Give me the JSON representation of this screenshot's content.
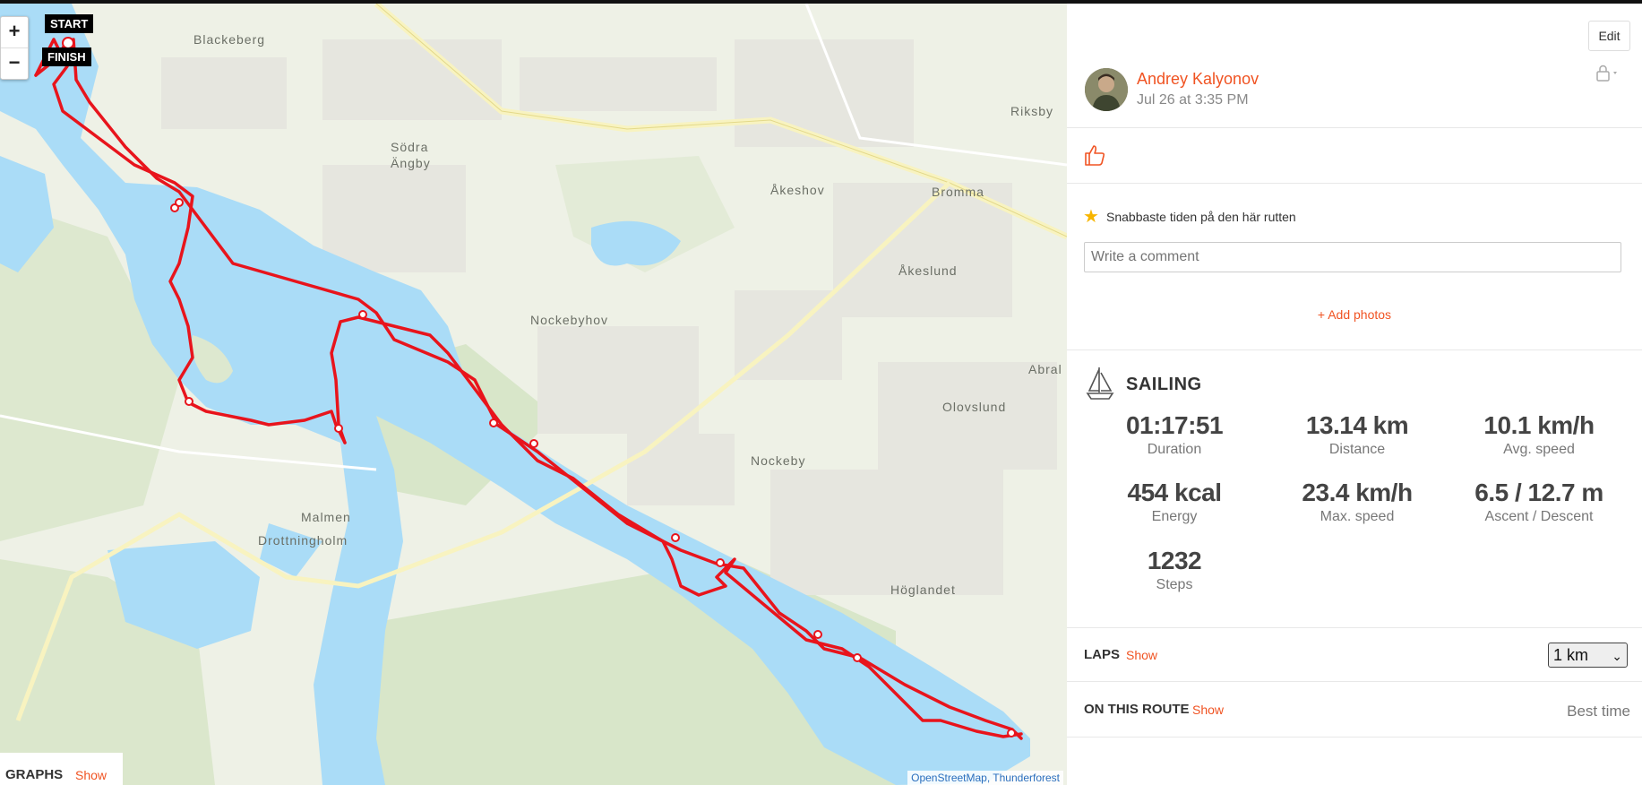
{
  "map": {
    "zoom_in": "+",
    "zoom_out": "−",
    "start_label": "START",
    "finish_label": "FINISH",
    "attribution": "OpenStreetMap, Thunderforest",
    "places": [
      "Blackeberg",
      "Södra",
      "Ängby",
      "Åkeshov",
      "Bromma",
      "Riksby",
      "Åkeslund",
      "Nockebyhov",
      "Abral",
      "Olovslund",
      "Nockeby",
      "Malmen",
      "Drottningholm",
      "Höglandet"
    ]
  },
  "graphs": {
    "title": "GRAPHS",
    "show": "Show"
  },
  "panel": {
    "edit_label": "Edit",
    "user_name": "Andrey Kalyonov",
    "date": "Jul 26 at 3:35 PM",
    "achievement": "Snabbaste tiden på den här rutten",
    "comment_placeholder": "Write a comment",
    "add_photos": "+ Add photos",
    "sport": "SAILING",
    "stats": [
      {
        "value": "01:17:51",
        "label": "Duration"
      },
      {
        "value": "13.14 km",
        "label": "Distance"
      },
      {
        "value": "10.1 km/h",
        "label": "Avg. speed"
      },
      {
        "value": "454 kcal",
        "label": "Energy"
      },
      {
        "value": "23.4 km/h",
        "label": "Max. speed"
      },
      {
        "value": "6.5 / 12.7 m",
        "label": "Ascent / Descent"
      },
      {
        "value": "1232",
        "label": "Steps"
      }
    ],
    "laps": {
      "title": "LAPS",
      "show": "Show",
      "select_value": "1 km"
    },
    "route": {
      "title": "ON THIS ROUTE",
      "show": "Show",
      "best": "Best time"
    }
  },
  "colors": {
    "accent": "#f05322",
    "route": "#e8141c",
    "water": "#aadcf7"
  }
}
